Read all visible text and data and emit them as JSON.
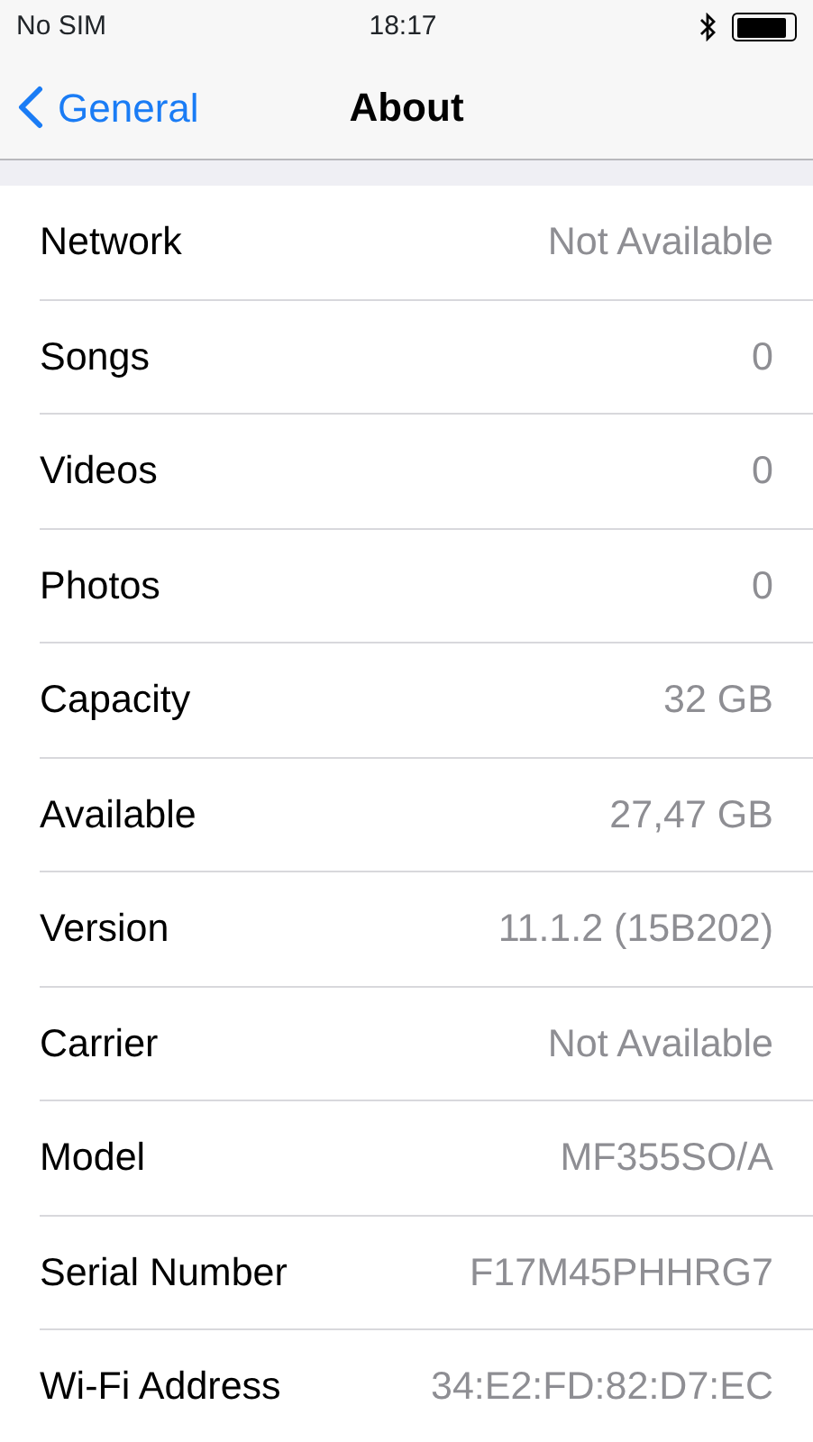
{
  "status_bar": {
    "carrier": "No SIM",
    "time": "18:17"
  },
  "nav_bar": {
    "back_label": "General",
    "title": "About"
  },
  "rows": [
    {
      "label": "Network",
      "value": "Not Available"
    },
    {
      "label": "Songs",
      "value": "0"
    },
    {
      "label": "Videos",
      "value": "0"
    },
    {
      "label": "Photos",
      "value": "0"
    },
    {
      "label": "Capacity",
      "value": "32 GB"
    },
    {
      "label": "Available",
      "value": "27,47 GB"
    },
    {
      "label": "Version",
      "value": "11.1.2 (15B202)"
    },
    {
      "label": "Carrier",
      "value": "Not Available"
    },
    {
      "label": "Model",
      "value": "MF355SO/A"
    },
    {
      "label": "Serial Number",
      "value": "F17M45PHHRG7"
    },
    {
      "label": "Wi-Fi Address",
      "value": "34:E2:FD:82:D7:EC"
    }
  ]
}
